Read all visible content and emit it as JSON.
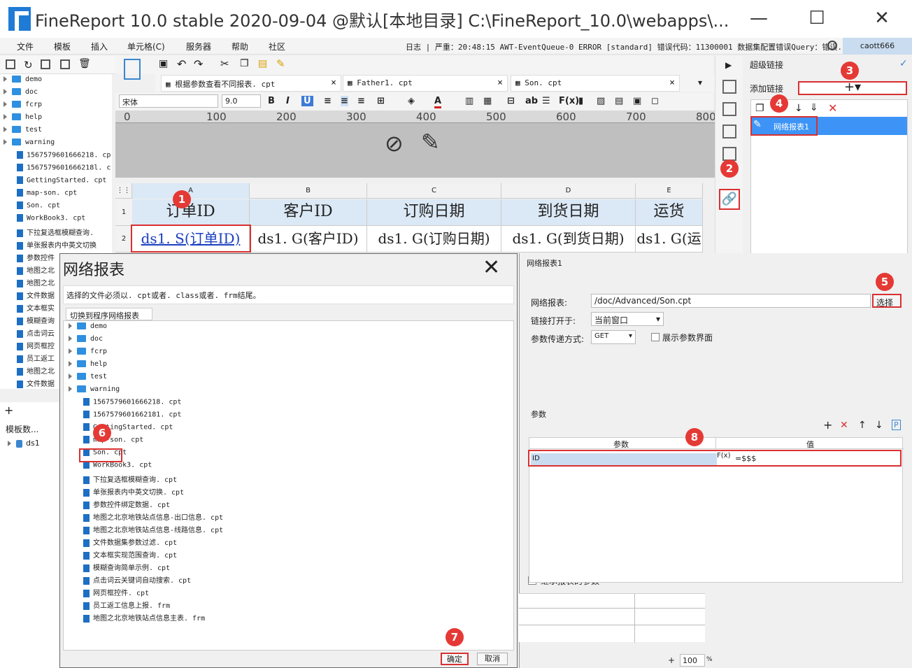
{
  "window": {
    "title": "FineReport 10.0 stable 2020-09-04 @默认[本地目录]    C:\\FineReport_10.0\\webapps\\..."
  },
  "menu": [
    "文件",
    "模板",
    "插入",
    "单元格(C)",
    "服务器",
    "帮助",
    "社区"
  ],
  "status": "日志 | 严重：20:48:15 AWT-EventQueue-0 ERROR [standard] 错误代码：11300001 数据集配置错误Query：错误...",
  "user": "caott666",
  "left_tree": [
    {
      "type": "folder",
      "label": "demo"
    },
    {
      "type": "folder",
      "label": "doc"
    },
    {
      "type": "folder",
      "label": "fcrp"
    },
    {
      "type": "folder",
      "label": "help"
    },
    {
      "type": "folder",
      "label": "test"
    },
    {
      "type": "folder",
      "label": "warning"
    },
    {
      "type": "file",
      "label": "1567579601666218. cp"
    },
    {
      "type": "file",
      "label": "1567579601666218l. c"
    },
    {
      "type": "file",
      "label": "GettingStarted. cpt"
    },
    {
      "type": "file",
      "label": "map-son. cpt"
    },
    {
      "type": "file",
      "label": "Son. cpt"
    },
    {
      "type": "file",
      "label": "WorkBook3. cpt"
    },
    {
      "type": "file",
      "label": "下拉复选框模糊查询."
    },
    {
      "type": "file",
      "label": "单张报表内中英文切换"
    },
    {
      "type": "file",
      "label": "参数控件"
    },
    {
      "type": "file",
      "label": "地图之北"
    },
    {
      "type": "file",
      "label": "地图之北"
    },
    {
      "type": "file",
      "label": "文件数据"
    },
    {
      "type": "file",
      "label": "文本框实"
    },
    {
      "type": "file",
      "label": "模糊查询"
    },
    {
      "type": "file",
      "label": "点击词云"
    },
    {
      "type": "file",
      "label": "网页框控"
    },
    {
      "type": "file",
      "label": "员工返工"
    },
    {
      "type": "file",
      "label": "地图之北"
    },
    {
      "type": "file",
      "label": "文件数据"
    }
  ],
  "left_bottom": {
    "tab": "模板数...",
    "dataset": "ds1"
  },
  "tabs": [
    {
      "label": "根据参数查看不同报表. cpt"
    },
    {
      "label": "Father1. cpt"
    },
    {
      "label": "Son. cpt"
    }
  ],
  "font": {
    "name": "宋体",
    "size": "9.0"
  },
  "ruler": [
    "0",
    "100",
    "200",
    "300",
    "400",
    "500",
    "600",
    "700",
    "800"
  ],
  "grid": {
    "columns": [
      "A",
      "B",
      "C",
      "D",
      "E"
    ],
    "rows": [
      "1",
      "2"
    ],
    "header": [
      "订单ID",
      "客户ID",
      "订购日期",
      "到货日期",
      "运货"
    ],
    "data": [
      "ds1. S(订单ID)",
      "ds1. G(客户ID)",
      "ds1. G(订购日期)",
      "ds1. G(到货日期)",
      "ds1. G(运"
    ]
  },
  "right_panel": {
    "title": "超级链接",
    "add_label": "添加链接",
    "link_item": "网络报表1"
  },
  "dialog": {
    "title": "网络报表",
    "notice": "选择的文件必须以. cpt或者. class或者. frm结尾。",
    "switch": "切换到程序网络报表",
    "folders": [
      "demo",
      "doc",
      "fcrp",
      "help",
      "test",
      "warning"
    ],
    "files": [
      "1567579601666218. cpt",
      "1567579601662181. cpt",
      "GettingStarted. cpt",
      "map-son. cpt",
      "Son. cpt",
      "WorkBook3. cpt",
      "下拉复选框模糊查询. cpt",
      "单张报表内中英文切换. cpt",
      "参数控件绑定数据. cpt",
      "地图之北京地铁站点信息-出口信息. cpt",
      "地图之北京地铁站点信息-线路信息. cpt",
      "文件数据集参数过滤. cpt",
      "文本框实现范围查询. cpt",
      "模糊查询简单示例. cpt",
      "点击词云关键词自动搜索. cpt",
      "网页框控件. cpt",
      "员工返工信息上报. frm",
      "地图之北京地铁站点信息主表. frm"
    ],
    "ok": "确定",
    "cancel": "取消"
  },
  "link_panel": {
    "name": "网络报表1",
    "report_label": "网络报表:",
    "report_value": "/doc/Advanced/Son.cpt",
    "select_btn": "选择",
    "open_label": "链接打开于:",
    "open_value": "当前窗口",
    "method_label": "参数传递方式:",
    "method_value": "GET",
    "show_param": "展示参数界面",
    "params_title": "参数",
    "param_col": "参数",
    "value_col": "值",
    "param_name": "ID",
    "param_value": "=$$$",
    "inherit": "继承报表的参数",
    "zoom": "100"
  },
  "badges": [
    "1",
    "2",
    "3",
    "4",
    "5",
    "6",
    "7",
    "8"
  ]
}
